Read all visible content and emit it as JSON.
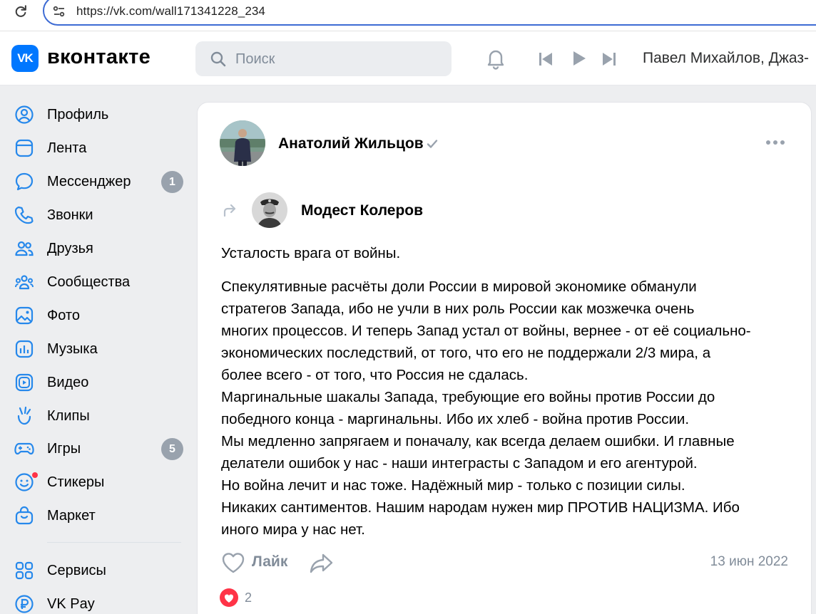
{
  "browser": {
    "url": "https://vk.com/wall171341228_234"
  },
  "header": {
    "logo_text": "VK",
    "wordmark": "вконтакте",
    "search_placeholder": "Поиск",
    "now_playing": "Павел Михайлов, Джаз-"
  },
  "sidebar": {
    "items": [
      {
        "label": "Профиль",
        "icon": "profile-icon"
      },
      {
        "label": "Лента",
        "icon": "feed-icon"
      },
      {
        "label": "Мессенджер",
        "icon": "messenger-icon",
        "count": "1"
      },
      {
        "label": "Звонки",
        "icon": "phone-icon"
      },
      {
        "label": "Друзья",
        "icon": "friends-icon"
      },
      {
        "label": "Сообщества",
        "icon": "communities-icon"
      },
      {
        "label": "Фото",
        "icon": "photo-icon"
      },
      {
        "label": "Музыка",
        "icon": "music-icon"
      },
      {
        "label": "Видео",
        "icon": "video-icon"
      },
      {
        "label": "Клипы",
        "icon": "clips-icon"
      },
      {
        "label": "Игры",
        "icon": "games-icon",
        "count": "5"
      },
      {
        "label": "Стикеры",
        "icon": "stickers-icon"
      },
      {
        "label": "Маркет",
        "icon": "market-icon"
      },
      {
        "label": "Сервисы",
        "icon": "services-icon"
      },
      {
        "label": "VK Pay",
        "icon": "vkpay-icon"
      }
    ]
  },
  "post": {
    "author": "Анатолий Жильцов",
    "original_author": "Модест Колеров",
    "title": "Усталость врага от войны.",
    "body_lines": [
      "Спекулятивные расчёты доли России в мировой экономике обманули",
      "стратегов Запада, ибо не учли в них роль России как мозжечка очень",
      "многих процессов. И теперь Запад устал от войны, вернее - от её социально-",
      "экономических последствий, от того, что его не поддержали 2/3 мира, а",
      "более всего - от того, что Россия не сдалась.",
      "Маргинальные шакалы Запада, требующие его войны против России до",
      "победного конца - маргинальны. Ибо их хлеб - война против России.",
      "Мы медленно запрягаем и поначалу, как всегда делаем ошибки. И главные",
      "делатели ошибок у нас - наши интеграсты с Западом и его агентурой.",
      "Но война лечит и нас тоже. Надёжный мир - только с позиции силы.",
      "Никаких сантиментов. Нашим народам нужен мир ПРОТИВ НАЦИЗМА. Ибо",
      "иного мира у нас нет."
    ],
    "like_label": "Лайк",
    "date": "13 июн 2022",
    "reactions_count": "2"
  },
  "colors": {
    "brand": "#0077ff",
    "accent_blue": "#3d6bd4",
    "muted": "#818c99",
    "badge": "#99a2ad",
    "heart": "#ff3347"
  }
}
